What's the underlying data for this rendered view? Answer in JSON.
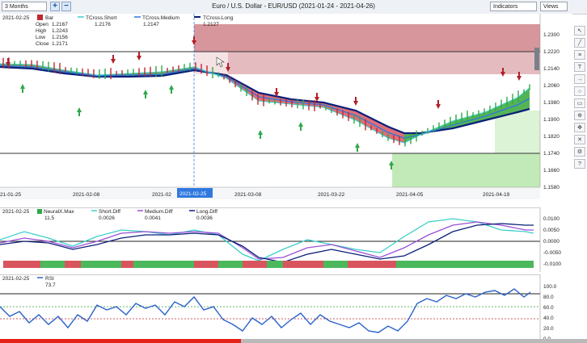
{
  "toolbar": {
    "timeframe": "3 Months",
    "add_btn": "+",
    "remove_btn": "−",
    "indicators": "Indicators",
    "views": "Views"
  },
  "title": "Euro / U.S. Dollar - EUR/USD (2021-01-24 - 2021-04-26)",
  "legend": {
    "date": "2021-02-25",
    "bar_label": "Bar",
    "open_label": "Open",
    "open": "1.2167",
    "high_label": "High",
    "high": "1.2243",
    "low_label": "Low",
    "low": "1.2156",
    "close_label": "Close",
    "close": "1.2171",
    "short_label": "TCross.Short",
    "short_value": "1.2176",
    "medium_label": "TCross.Medium",
    "medium_value": "1.2147",
    "long_label": "TCross.Long",
    "long_value": "1.2127"
  },
  "diff_legend": {
    "date": "2021-02-25",
    "nmax_label": "NeuralX.Max",
    "nmax_value": "11.5",
    "short_label": "Short.Diff",
    "short_value": "0.0026",
    "medium_label": "Medium.Diff",
    "medium_value": "0.0041",
    "long_label": "Long.Diff",
    "long_value": "0.0036"
  },
  "rsi_legend": {
    "date": "2021-02-25",
    "label": "RSI",
    "value": "73.7"
  },
  "x_axis": {
    "labels": [
      "21-01-25",
      "2021-02-08",
      "2021-02",
      "2021-02-25",
      "2021-03-08",
      "2021-03-22",
      "2021-04-05",
      "2021-04-19"
    ]
  },
  "price_axis": [
    "1.2300",
    "1.2220",
    "1.2140",
    "1.2060",
    "1.1980",
    "1.1900",
    "1.1820",
    "1.1740",
    "1.1660",
    "1.1580"
  ],
  "diff_axis": [
    "0.0100",
    "0.0050",
    "0.0000",
    "-0.0050",
    "-0.0100"
  ],
  "rsi_axis": [
    "100.0",
    "80.0",
    "60.0",
    "40.0",
    "20.0",
    "0.0"
  ],
  "colors": {
    "short": "#3ad0c8",
    "medium": "#2f78e0",
    "long": "#0a1f7a",
    "up": "#2fa84a",
    "down": "#c0282f",
    "resistance": "#c9737a",
    "support": "#aee3a0",
    "rsi": "#2a62c9",
    "purple": "#9a4fd6"
  },
  "side_icons": [
    "pointer-icon",
    "line-icon",
    "fib-icon",
    "text-icon",
    "arrow-icon",
    "circle-icon",
    "ruler-icon",
    "zoom-icon",
    "pan-icon",
    "delete-icon",
    "settings-icon",
    "help-icon"
  ]
}
